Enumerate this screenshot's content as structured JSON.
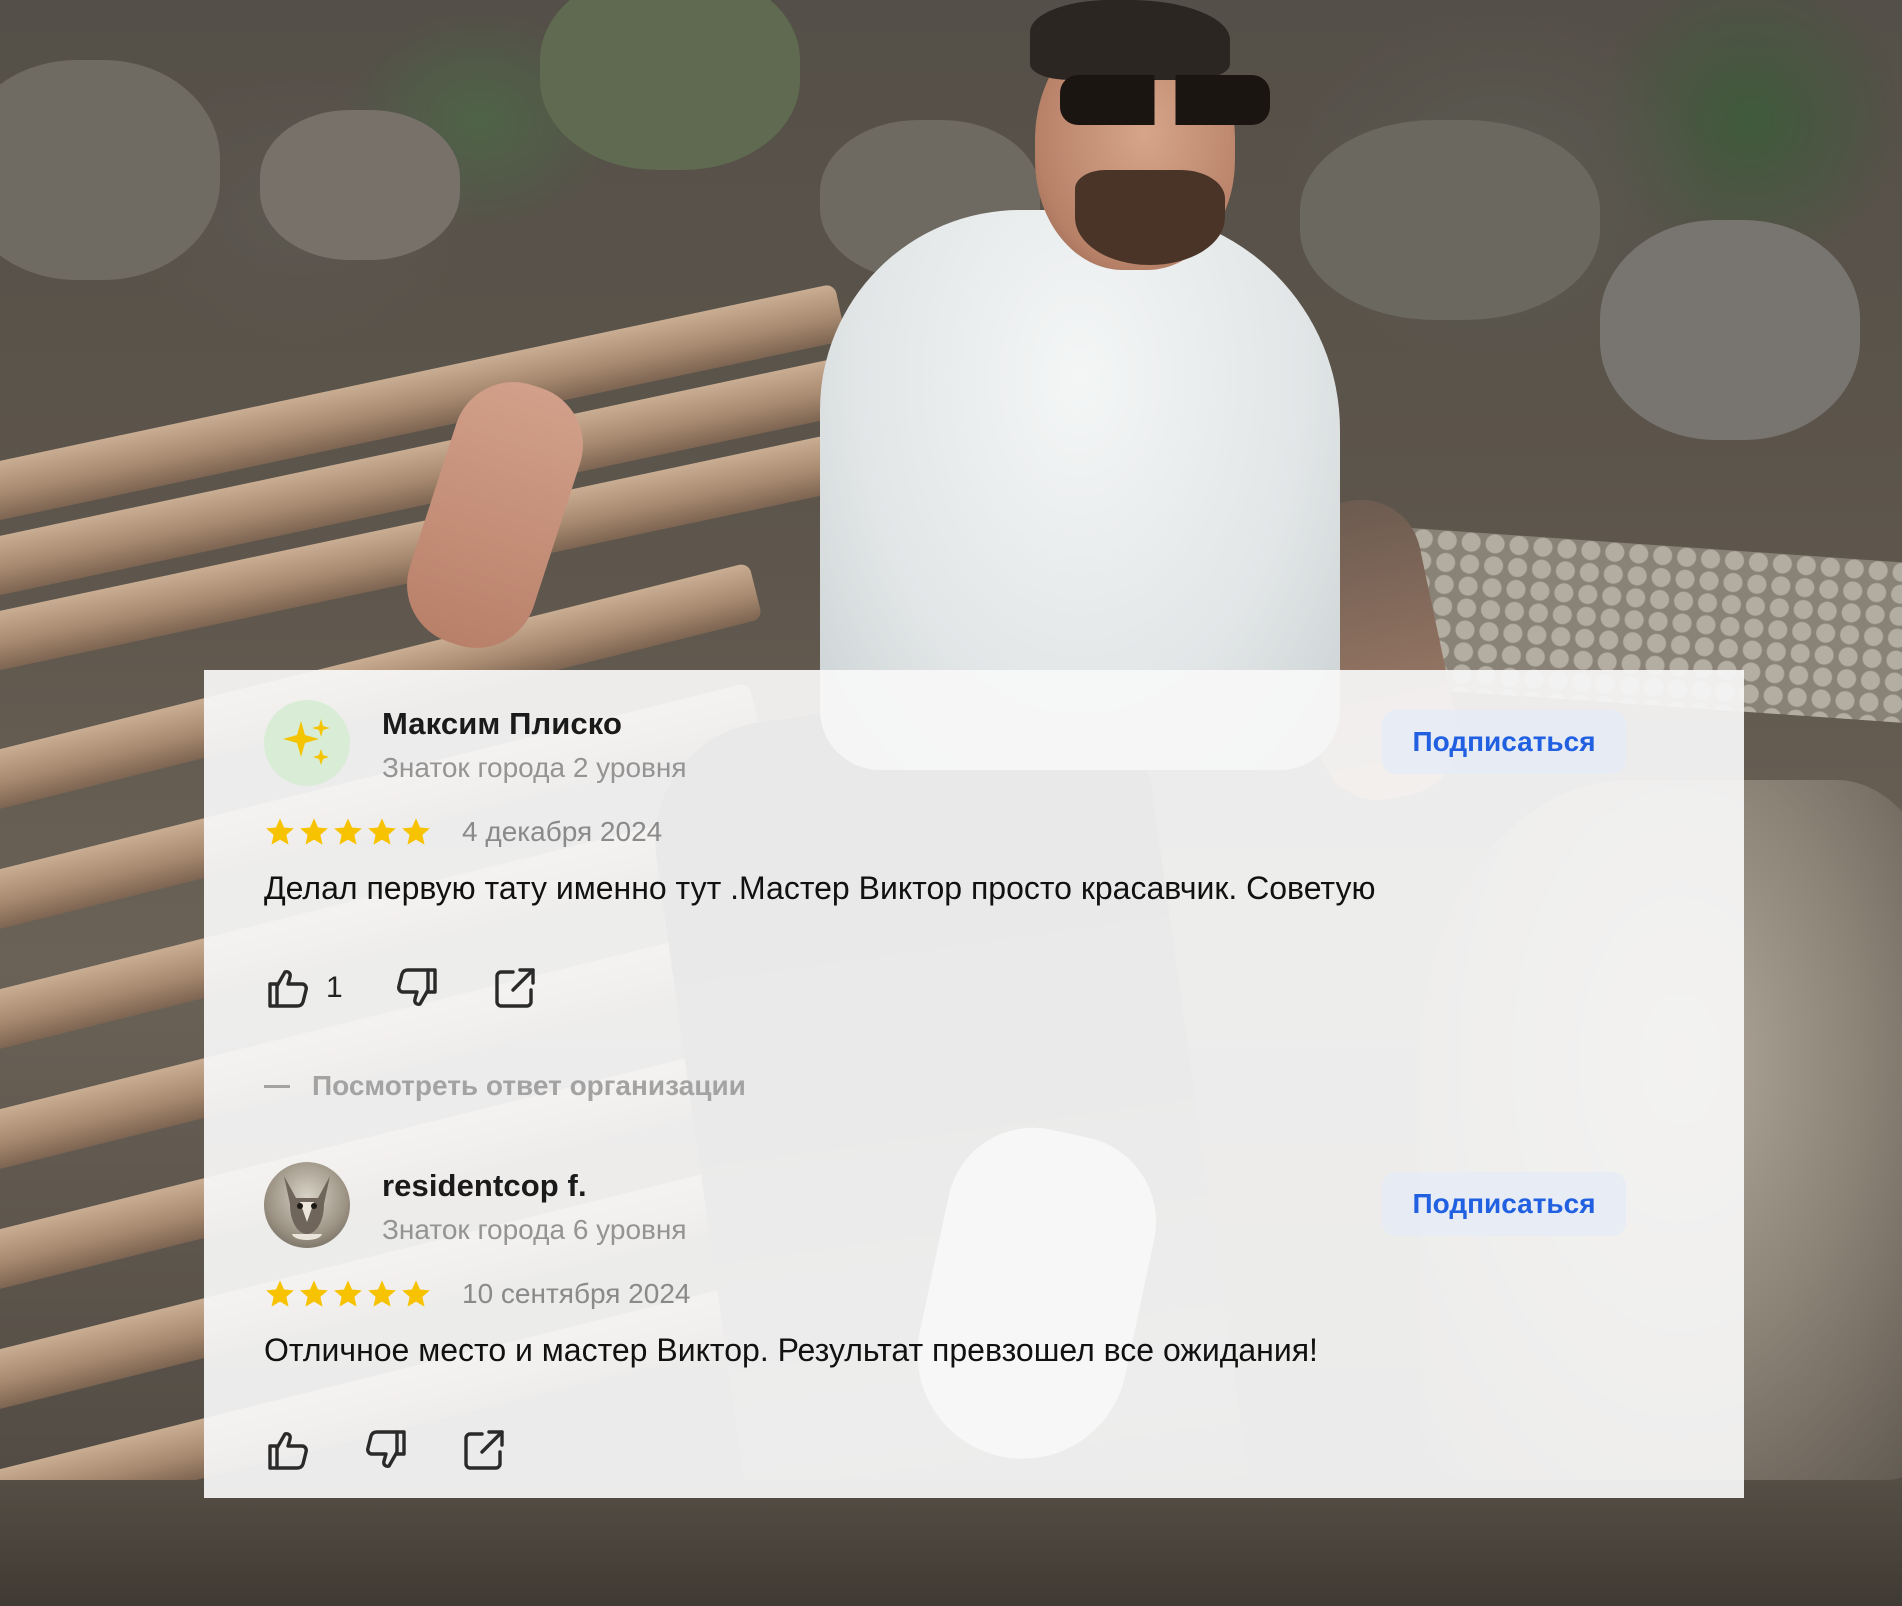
{
  "colors": {
    "card_background": "#f8f8f8",
    "author_name": "#1a1a1a",
    "muted_text": "#949494",
    "subscribe_text": "#2160e0",
    "subscribe_bg": "#e6ebf5",
    "star": "#f7c300"
  },
  "reviews": [
    {
      "author": "Максим Плиско",
      "level": "Знаток города 2 уровня",
      "avatar_icon": "sparkles-icon",
      "rating": 5,
      "date": "4 декабря 2024",
      "text": "Делал первую тату именно тут .Мастер Виктор просто красавчик. Советую",
      "likes": "1",
      "subscribe_label": "Подписаться",
      "org_response_label": "Посмотреть ответ организации"
    },
    {
      "author": "residentcop f.",
      "level": "Знаток города 6 уровня",
      "avatar_icon": "dog-photo-avatar",
      "rating": 5,
      "date": "10 сентября 2024",
      "text": "Отличное место и мастер Виктор. Результат превзошел все ожидания!",
      "subscribe_label": "Подписаться"
    }
  ]
}
